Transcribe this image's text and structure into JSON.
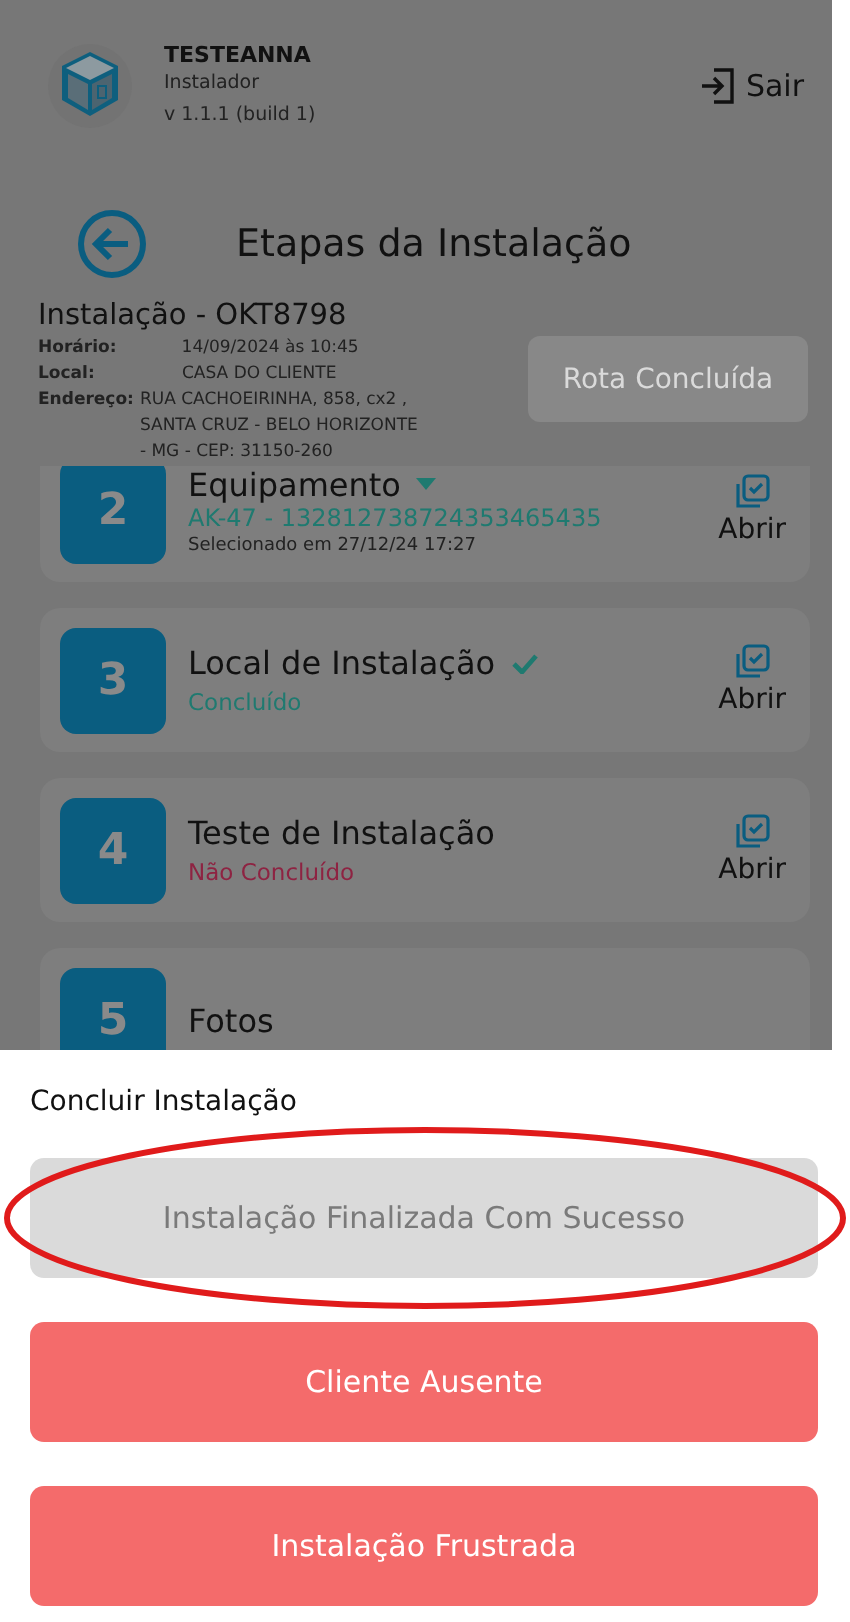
{
  "header": {
    "user": "TESTEANNA",
    "role": "Instalador",
    "version": "v 1.1.1 (build 1)",
    "logout": "Sair"
  },
  "page_title": "Etapas da Instalação",
  "installation": {
    "title": "Instalação - OKT8798",
    "fields": [
      {
        "label": "Horário:",
        "lines": [
          "14/09/2024 às 10:45"
        ]
      },
      {
        "label": "Local:",
        "lines": [
          "CASA DO CLIENTE"
        ]
      },
      {
        "label": "Endereço:",
        "lines": [
          "RUA CACHOEIRINHA, 858, cx2 ,",
          "SANTA CRUZ  -  BELO HORIZONTE",
          "-  MG  -  CEP: 31150-260"
        ]
      }
    ]
  },
  "route_button": {
    "label": "Rota Concluída",
    "disabled": true
  },
  "steps": [
    {
      "kind": "equipment",
      "number": "2",
      "title": "Equipamento",
      "detail": "AK-47 - 132812738724353465435",
      "note": "Selecionado em 27/12/24 17:27",
      "action": "Abrir"
    },
    {
      "kind": "status",
      "number": "3",
      "title": "Local de Instalação",
      "done": true,
      "status": "Concluído",
      "action": "Abrir"
    },
    {
      "kind": "status",
      "number": "4",
      "title": "Teste de Instalação",
      "done": false,
      "status": "Não Concluído",
      "action": "Abrir"
    },
    {
      "kind": "status",
      "number": "5",
      "title": "Fotos",
      "done": false
    }
  ],
  "sheet": {
    "title": "Concluir Instalação",
    "buttons": [
      {
        "label": "Instalação Finalizada Com Sucesso",
        "disabled": true,
        "highlighted": true
      },
      {
        "label": "Cliente Ausente",
        "disabled": false,
        "highlighted": false
      },
      {
        "label": "Instalação Frustrada",
        "disabled": false,
        "highlighted": false
      }
    ]
  }
}
